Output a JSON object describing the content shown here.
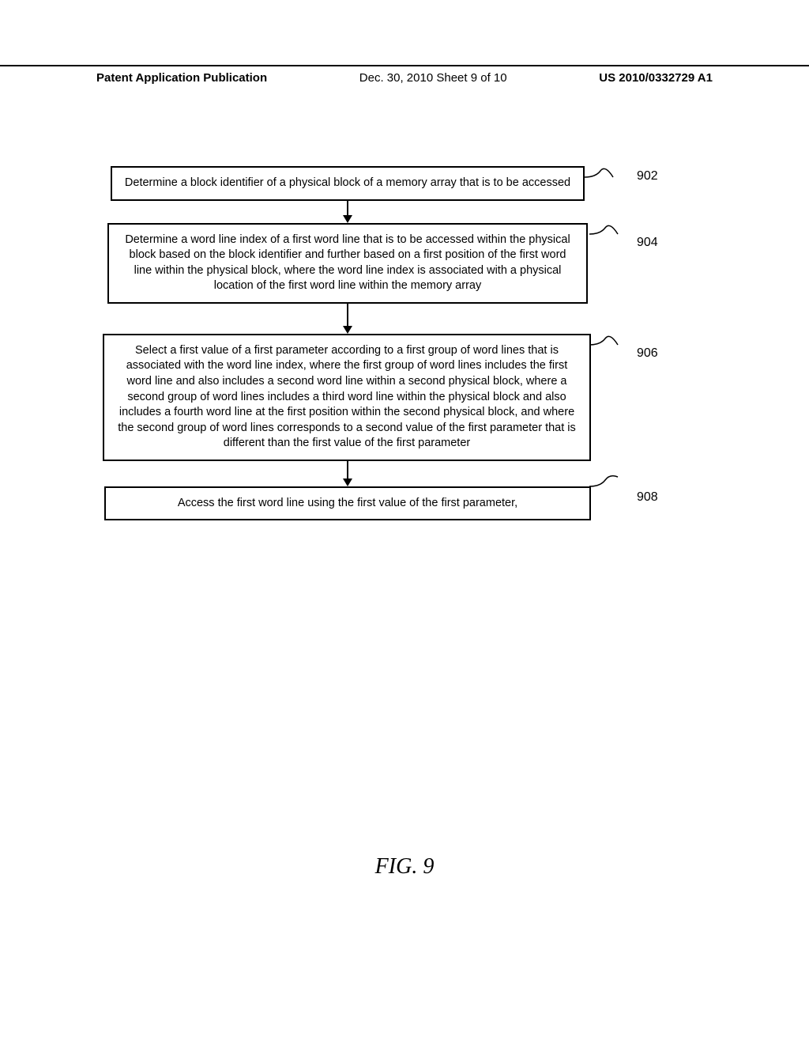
{
  "header": {
    "left": "Patent Application Publication",
    "center": "Dec. 30, 2010  Sheet 9 of 10",
    "right": "US 2010/0332729 A1"
  },
  "flow": {
    "step1": {
      "text": "Determine a block identifier of a physical block of a memory array that is to be accessed",
      "label": "902"
    },
    "step2": {
      "text": "Determine a word line index of a first word line that is to be accessed within the physical block based on the block identifier and further based on a first position of the first word line within the physical block, where the word line index is associated with a physical location of the first word line within the memory array",
      "label": "904"
    },
    "step3": {
      "text": "Select a first value of a first parameter according to a first group of word lines that is associated with the word line index, where the first group of word lines includes the first word line and also includes a second word line within a second physical block, where a second group of word lines includes a third word line within the physical block and also includes a fourth word line at the first position within the second physical block, and where the second group of word lines corresponds to a second value of the first parameter that is different than the first value of the first parameter",
      "label": "906"
    },
    "step4": {
      "text": "Access the first word line using the first value of the first parameter,",
      "label": "908"
    }
  },
  "figure_label": "FIG.  9"
}
